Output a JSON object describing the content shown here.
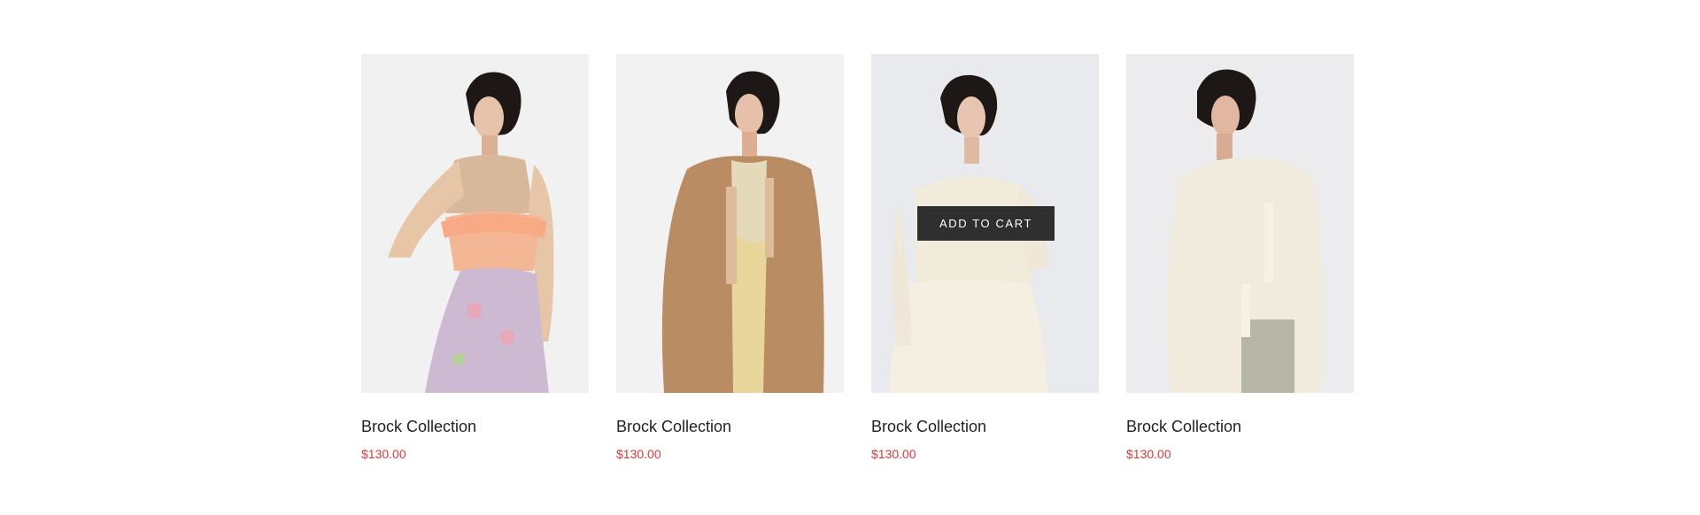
{
  "colors": {
    "accent_price": "#d93a3a",
    "button_bg": "#2f2f2f"
  },
  "products": [
    {
      "name": "Brock Collection",
      "price": "$130.00"
    },
    {
      "name": "Brock Collection",
      "price": "$130.00"
    },
    {
      "name": "Brock Collection",
      "price": "$130.00",
      "cart_label": "ADD TO CART"
    },
    {
      "name": "Brock Collection",
      "price": "$130.00"
    }
  ]
}
